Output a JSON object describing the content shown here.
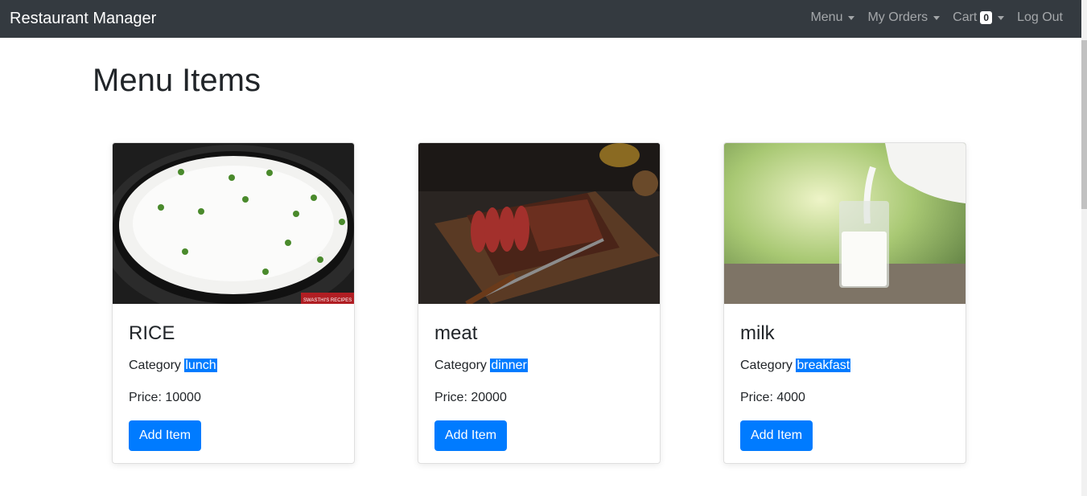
{
  "navbar": {
    "brand": "Restaurant Manager",
    "menu_label": "Menu",
    "orders_label": "My Orders",
    "cart_label": "Cart",
    "cart_count": "0",
    "logout_label": "Log Out"
  },
  "page": {
    "title": "Menu Items"
  },
  "items": [
    {
      "name": "RICE",
      "category_label": "Category",
      "category": "lunch",
      "price_text": "Price: 10000",
      "button_label": "Add Item",
      "image_watermark": "SWASTHI'S RECIPES"
    },
    {
      "name": "meat",
      "category_label": "Category",
      "category": "dinner",
      "price_text": "Price: 20000",
      "button_label": "Add Item"
    },
    {
      "name": "milk",
      "category_label": "Category",
      "category": "breakfast",
      "price_text": "Price: 4000",
      "button_label": "Add Item"
    }
  ],
  "colors": {
    "navbar_bg": "#343a40",
    "accent": "#007bff"
  }
}
